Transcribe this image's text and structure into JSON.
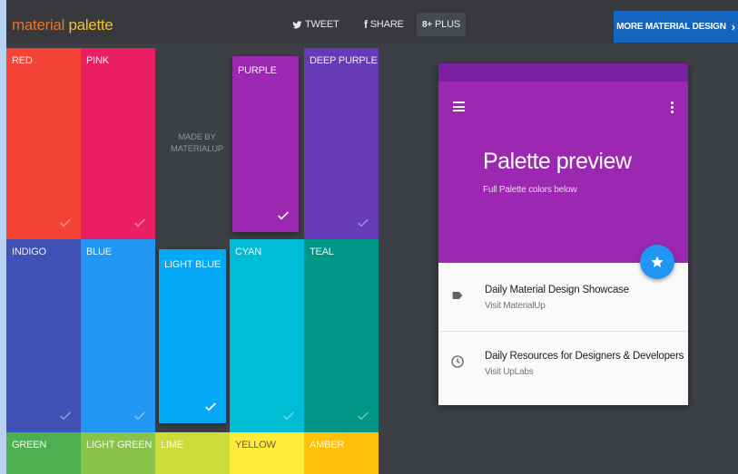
{
  "header": {
    "logo_word1": "material",
    "logo_word2": "palette",
    "tweet_label": "TWEET",
    "share_label": "SHARE",
    "plus_label": "PLUS",
    "plus_glyph": "8+",
    "more_label": "MORE MATERIAL DESIGN",
    "more_chevron": "›"
  },
  "made_by": {
    "line1": "MADE BY",
    "line2": "MATERIALUP"
  },
  "palette": {
    "colors": [
      {
        "name": "RED",
        "hex": "#f44336"
      },
      {
        "name": "PINK",
        "hex": "#e91e63"
      },
      {
        "name": "PURPLE",
        "hex": "#9c27b0",
        "selected": true
      },
      {
        "name": "DEEP PURPLE",
        "hex": "#673ab7"
      },
      {
        "name": "INDIGO",
        "hex": "#3f51b5"
      },
      {
        "name": "BLUE",
        "hex": "#2196f3"
      },
      {
        "name": "LIGHT BLUE",
        "hex": "#03a9f4",
        "selected": true
      },
      {
        "name": "CYAN",
        "hex": "#00bcd4"
      },
      {
        "name": "TEAL",
        "hex": "#009688"
      },
      {
        "name": "GREEN",
        "hex": "#4caf50"
      },
      {
        "name": "LIGHT GREEN",
        "hex": "#8bc34a"
      },
      {
        "name": "LIME",
        "hex": "#cddc39"
      },
      {
        "name": "YELLOW",
        "hex": "#ffeb3b"
      },
      {
        "name": "AMBER",
        "hex": "#ffc107"
      }
    ]
  },
  "preview": {
    "title": "Palette preview",
    "subtitle": "Full Palette colors below",
    "primary_color": "#9c27b0",
    "primary_dark_color": "#7b1fa2",
    "accent_color": "#2196f3",
    "items": [
      {
        "title": "Daily Material Design Showcase",
        "subtitle": "Visit MaterialUp",
        "icon": "label-icon"
      },
      {
        "title": "Daily Resources for Designers & Developers",
        "subtitle": "Visit UpLabs",
        "icon": "clock-icon"
      }
    ]
  }
}
